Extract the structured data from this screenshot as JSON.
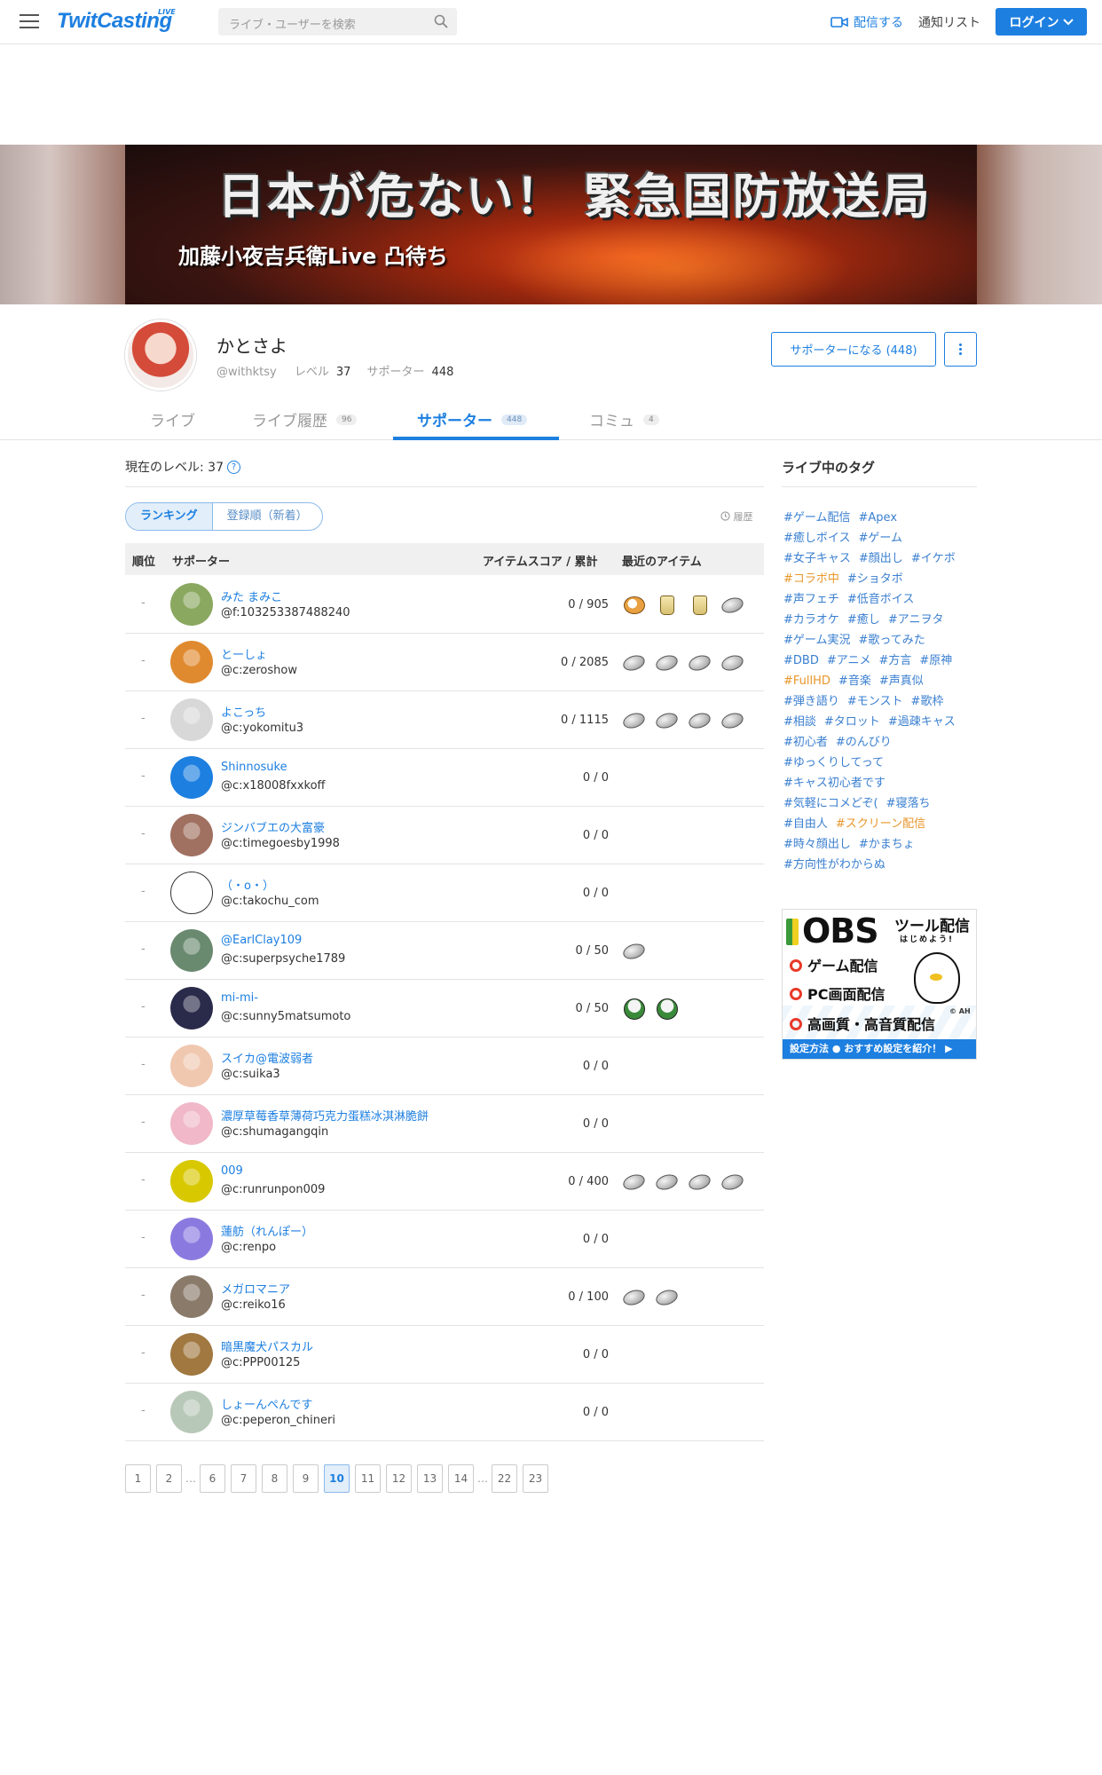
{
  "header": {
    "logo": "TwitCasting",
    "logo_live": "LIVE",
    "search_placeholder": "ライブ・ユーザーを検索",
    "broadcast_label": "配信する",
    "notification_label": "通知リスト",
    "login_label": "ログイン"
  },
  "banner": {
    "title": "日本が危ない！ 緊急国防放送局",
    "subtitle": "加藤小夜吉兵衛Live 凸待ち"
  },
  "profile": {
    "name": "かとさよ",
    "handle": "@withktsy",
    "level_label": "レベル",
    "level_value": "37",
    "supporter_label": "サポーター",
    "supporter_value": "448",
    "become_supporter": "サポーターになる (448)"
  },
  "tabs": [
    {
      "label": "ライブ",
      "count": ""
    },
    {
      "label": "ライブ履歴",
      "count": "96"
    },
    {
      "label": "サポーター",
      "count": "448"
    },
    {
      "label": "コミュ",
      "count": "4"
    }
  ],
  "main": {
    "current_level": "現在のレベル: 37",
    "seg_ranking": "ランキング",
    "seg_newest": "登録順（新着）",
    "history": "履歴",
    "col_rank": "順位",
    "col_supporter": "サポーター",
    "col_score": "アイテムスコア / 累計",
    "col_items": "最近のアイテム"
  },
  "rows": [
    {
      "rank": "-",
      "name": "みた まみこ",
      "id": "@f:103253387488240",
      "score": "0 / 905",
      "items": [
        "bird",
        "cup",
        "cup",
        "coin"
      ],
      "avatar": "#8aa860"
    },
    {
      "rank": "-",
      "name": "とーしょ",
      "id": "@c:zeroshow",
      "score": "0 / 2085",
      "items": [
        "coin",
        "coin",
        "coin",
        "coin"
      ],
      "avatar": "#e08a30"
    },
    {
      "rank": "-",
      "name": "よこっち",
      "id": "@c:yokomitu3",
      "score": "0 / 1115",
      "items": [
        "coin",
        "coin",
        "coin",
        "coin"
      ],
      "avatar": "#d8d8d8"
    },
    {
      "rank": "-",
      "name": "Shinnosuke",
      "id": "@c:x18008fxxkoff",
      "score": "0 / 0",
      "items": [],
      "avatar": "#1d7fe0"
    },
    {
      "rank": "-",
      "name": "ジンバブエの大富豪",
      "id": "@c:timegoesby1998",
      "score": "0 / 0",
      "items": [],
      "avatar": "#a07060"
    },
    {
      "rank": "-",
      "name": "（・о・）",
      "id": "@c:takochu_com",
      "score": "0 / 0",
      "items": [],
      "avatar": "#ffffff"
    },
    {
      "rank": "-",
      "name": "@EarlClay109",
      "id": "@c:superpsyche1789",
      "score": "0 / 50",
      "items": [
        "coin"
      ],
      "avatar": "#6a8a70"
    },
    {
      "rank": "-",
      "name": "mi-mi-",
      "id": "@c:sunny5matsumoto",
      "score": "0 / 50",
      "items": [
        "onigiri",
        "onigiri"
      ],
      "avatar": "#2a2a4a"
    },
    {
      "rank": "-",
      "name": "スイカ@電波弱者",
      "id": "@c:suika3",
      "score": "0 / 0",
      "items": [],
      "avatar": "#f0c8b0"
    },
    {
      "rank": "-",
      "name": "濃厚草莓香草薄荷巧克力蛋糕冰淇淋脆餅",
      "id": "@c:shumagangqin",
      "score": "0 / 0",
      "items": [],
      "avatar": "#f0b8c8"
    },
    {
      "rank": "-",
      "name": "009",
      "id": "@c:runrunpon009",
      "score": "0 / 400",
      "items": [
        "coin",
        "coin",
        "coin",
        "coin"
      ],
      "avatar": "#d8c800"
    },
    {
      "rank": "-",
      "name": "蓮舫（れんぽー）",
      "id": "@c:renpo",
      "score": "0 / 0",
      "items": [],
      "avatar": "#8a7ae0"
    },
    {
      "rank": "-",
      "name": "メガロマニア",
      "id": "@c:reiko16",
      "score": "0 / 100",
      "items": [
        "coin",
        "coin"
      ],
      "avatar": "#8a7a6a"
    },
    {
      "rank": "-",
      "name": "暗黒魔犬パスカル",
      "id": "@c:PPP00125",
      "score": "0 / 0",
      "items": [],
      "avatar": "#a07840"
    },
    {
      "rank": "-",
      "name": "しょーんぺんです",
      "id": "@c:peperon_chineri",
      "score": "0 / 0",
      "items": [],
      "avatar": "#b8c8b8"
    }
  ],
  "pagination": [
    "1",
    "2",
    "…",
    "6",
    "7",
    "8",
    "9",
    "10",
    "11",
    "12",
    "13",
    "14",
    "…",
    "22",
    "23"
  ],
  "pagination_current": "10",
  "sidebar": {
    "title": "ライブ中のタグ",
    "tag_lines": [
      [
        {
          "t": "#ゲーム配信",
          "hot": false
        },
        {
          "t": "#Apex",
          "hot": false
        }
      ],
      [
        {
          "t": "#癒しボイス",
          "hot": false
        },
        {
          "t": "#ゲーム",
          "hot": false
        }
      ],
      [
        {
          "t": "#女子キャス",
          "hot": false
        },
        {
          "t": "#顔出し",
          "hot": false
        },
        {
          "t": "#イケボ",
          "hot": false
        }
      ],
      [
        {
          "t": "#コラボ中",
          "hot": true
        },
        {
          "t": "#ショタボ",
          "hot": false
        }
      ],
      [
        {
          "t": "#声フェチ",
          "hot": false
        },
        {
          "t": "#低音ボイス",
          "hot": false
        }
      ],
      [
        {
          "t": "#カラオケ",
          "hot": false
        },
        {
          "t": "#癒し",
          "hot": false
        },
        {
          "t": "#アニヲタ",
          "hot": false
        }
      ],
      [
        {
          "t": "#ゲーム実況",
          "hot": false
        },
        {
          "t": "#歌ってみた",
          "hot": false
        }
      ],
      [
        {
          "t": "#DBD",
          "hot": false
        },
        {
          "t": "#アニメ",
          "hot": false
        },
        {
          "t": "#方言",
          "hot": false
        },
        {
          "t": "#原神",
          "hot": false
        }
      ],
      [
        {
          "t": "#FullHD",
          "hot": true
        },
        {
          "t": "#音楽",
          "hot": false
        },
        {
          "t": "#声真似",
          "hot": false
        }
      ],
      [
        {
          "t": "#弾き語り",
          "hot": false
        },
        {
          "t": "#モンスト",
          "hot": false
        },
        {
          "t": "#歌枠",
          "hot": false
        }
      ],
      [
        {
          "t": "#相談",
          "hot": false
        },
        {
          "t": "#タロット",
          "hot": false
        },
        {
          "t": "#過疎キャス",
          "hot": false
        }
      ],
      [
        {
          "t": "#初心者",
          "hot": false
        },
        {
          "t": "#のんびり",
          "hot": false
        }
      ],
      [
        {
          "t": "#ゆっくりしてって",
          "hot": false
        }
      ],
      [
        {
          "t": "#キャス初心者です",
          "hot": false
        }
      ],
      [
        {
          "t": "#気軽にコメどぞ(",
          "hot": false
        },
        {
          "t": "#寝落ち",
          "hot": false
        }
      ],
      [
        {
          "t": "#自由人",
          "hot": false
        },
        {
          "t": "#スクリーン配信",
          "hot": true
        }
      ],
      [
        {
          "t": "#時々顔出し",
          "hot": false
        },
        {
          "t": "#かまちょ",
          "hot": false
        }
      ],
      [
        {
          "t": "#方向性がわからぬ",
          "hot": false
        }
      ]
    ],
    "ad": {
      "obs": "OBS",
      "tool": "ツール配信",
      "tool_sub": "はじめよう!",
      "line1": "ゲーム配信",
      "line2": "PC画面配信",
      "line3": "高画質・高音質配信",
      "ah": "© AH",
      "footer": "設定方法 ● おすすめ設定を紹介！ ▶"
    }
  },
  "colors": {
    "accent": "#1d7fe0",
    "hot_tag": "#e8962a",
    "tag": "#3a7fd0"
  }
}
